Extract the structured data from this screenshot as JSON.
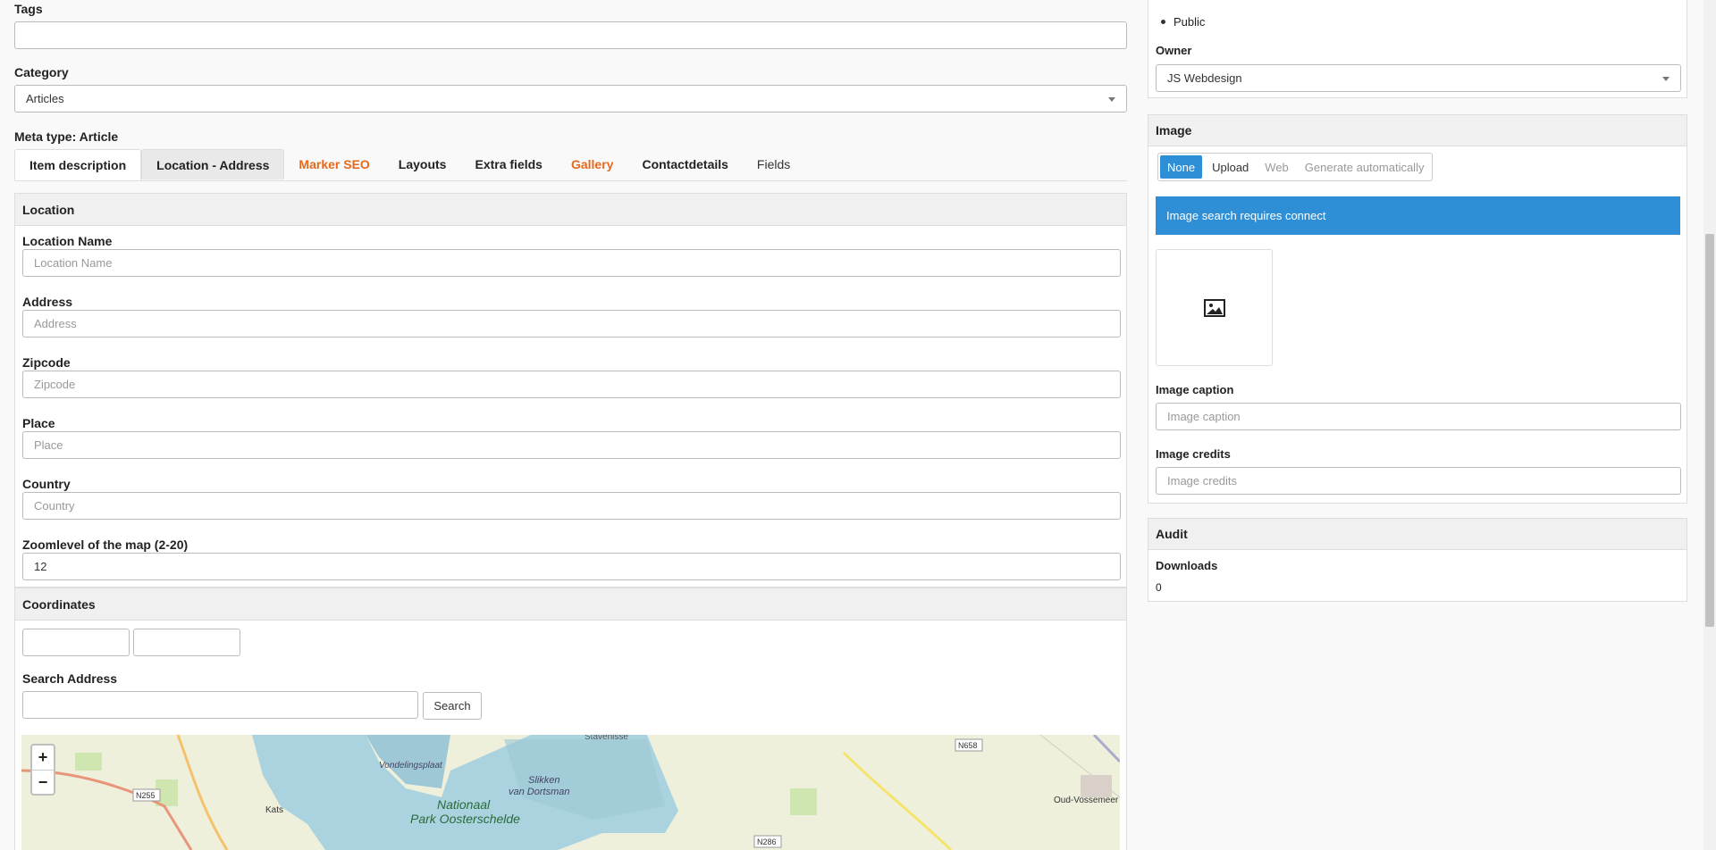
{
  "tags": {
    "label": "Tags",
    "value": ""
  },
  "category": {
    "label": "Category",
    "value": "Articles"
  },
  "meta_type": "Meta type: Article",
  "tabs": [
    {
      "label": "Item description"
    },
    {
      "label": "Location - Address"
    },
    {
      "label": "Marker SEO"
    },
    {
      "label": "Layouts"
    },
    {
      "label": "Extra fields"
    },
    {
      "label": "Gallery"
    },
    {
      "label": "Contactdetails"
    },
    {
      "label": "Fields"
    }
  ],
  "location": {
    "heading": "Location",
    "fields": [
      {
        "label": "Location Name",
        "placeholder": "Location Name"
      },
      {
        "label": "Address",
        "placeholder": "Address"
      },
      {
        "label": "Zipcode",
        "placeholder": "Zipcode"
      },
      {
        "label": "Place",
        "placeholder": "Place"
      },
      {
        "label": "Country",
        "placeholder": "Country"
      }
    ],
    "zoom": {
      "label": "Zoomlevel of the map (2-20)",
      "value": "12"
    }
  },
  "coordinates": {
    "heading": "Coordinates",
    "search_label": "Search Address",
    "search_button": "Search"
  },
  "map": {
    "zoom_in": "+",
    "zoom_out": "−",
    "labels": {
      "stavenisse": "Stavenisse",
      "vondelingsplaat": "Vondelingsplaat",
      "slikken": "Slikken",
      "van_dortsman": "van Dortsman",
      "nationaal": "Nationaal",
      "park": "Park Oosterschelde",
      "kats": "Kats",
      "n255": "N255",
      "n658": "N658",
      "n286": "N286",
      "oud_vossemeer": "Oud-Vossemeer"
    }
  },
  "sidebar": {
    "viewed_by_item": "Public",
    "owner": {
      "label": "Owner",
      "value": "JS Webdesign"
    },
    "image": {
      "heading": "Image",
      "modes": [
        "None",
        "Upload",
        "Web",
        "Generate automatically"
      ],
      "notice": "Image search requires connect",
      "caption": {
        "label": "Image caption",
        "placeholder": "Image caption"
      },
      "credits": {
        "label": "Image credits",
        "placeholder": "Image credits"
      }
    },
    "audit": {
      "heading": "Audit",
      "downloads_label": "Downloads",
      "downloads_value": "0"
    }
  },
  "colors": {
    "accent": "#2f8fd6",
    "orange_tab": "#e8681c"
  }
}
